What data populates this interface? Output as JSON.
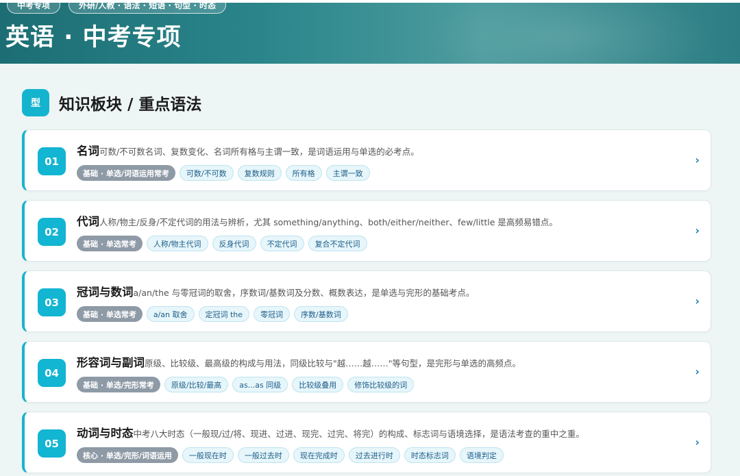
{
  "header": {
    "pills": [
      "中考专项",
      "外研/人教 · 语法 · 短语 · 句型 · 时态"
    ],
    "title": "英语 · 中考专项"
  },
  "section": {
    "badge": "型",
    "title": "知识板块 / 重点语法"
  },
  "cards": [
    {
      "num": "01",
      "title": "名词",
      "desc": "可数/不可数名词、复数变化、名词所有格与主谓一致，是词语运用与单选的必考点。",
      "level": "基础 · 单选/词语运用常考",
      "tags": [
        "可数/不可数",
        "复数规则",
        "所有格",
        "主谓一致"
      ]
    },
    {
      "num": "02",
      "title": "代词",
      "desc": "人称/物主/反身/不定代词的用法与辨析，尤其 something/anything、both/either/neither、few/little 是高频易错点。",
      "level": "基础 · 单选常考",
      "tags": [
        "人称/物主代词",
        "反身代词",
        "不定代词",
        "复合不定代词"
      ]
    },
    {
      "num": "03",
      "title": "冠词与数词",
      "desc": "a/an/the 与零冠词的取舍，序数词/基数词及分数、概数表达，是单选与完形的基础考点。",
      "level": "基础 · 单选常考",
      "tags": [
        "a/an 取舍",
        "定冠词 the",
        "零冠词",
        "序数/基数词"
      ]
    },
    {
      "num": "04",
      "title": "形容词与副词",
      "desc": "原级、比较级、最高级的构成与用法，同级比较与\"越……越……\"等句型，是完形与单选的高频点。",
      "level": "基础 · 单选/完形常考",
      "tags": [
        "原级/比较/最高",
        "as...as 同级",
        "比较级叠用",
        "修饰比较级的词"
      ]
    },
    {
      "num": "05",
      "title": "动词与时态",
      "desc": "中考八大时态（一般现/过/将、现进、过进、现完、过完、将完）的构成、标志词与语境选择，是语法考查的重中之重。",
      "level": "核心 · 单选/完形/词语运用",
      "tags": [
        "一般现在时",
        "一般过去时",
        "现在完成时",
        "过去进行时",
        "时态标志词",
        "语境判定"
      ]
    }
  ],
  "icons": {
    "card_arrow": "chevron-right-icon",
    "chevron_glyph": "›"
  },
  "colors": {
    "accent": "#12b5d2",
    "header_bg": "#2a858a",
    "level_tag": "#8e9aa6",
    "topic_tag_bg": "#e6f6fb",
    "topic_tag_text": "#1f5d87"
  }
}
